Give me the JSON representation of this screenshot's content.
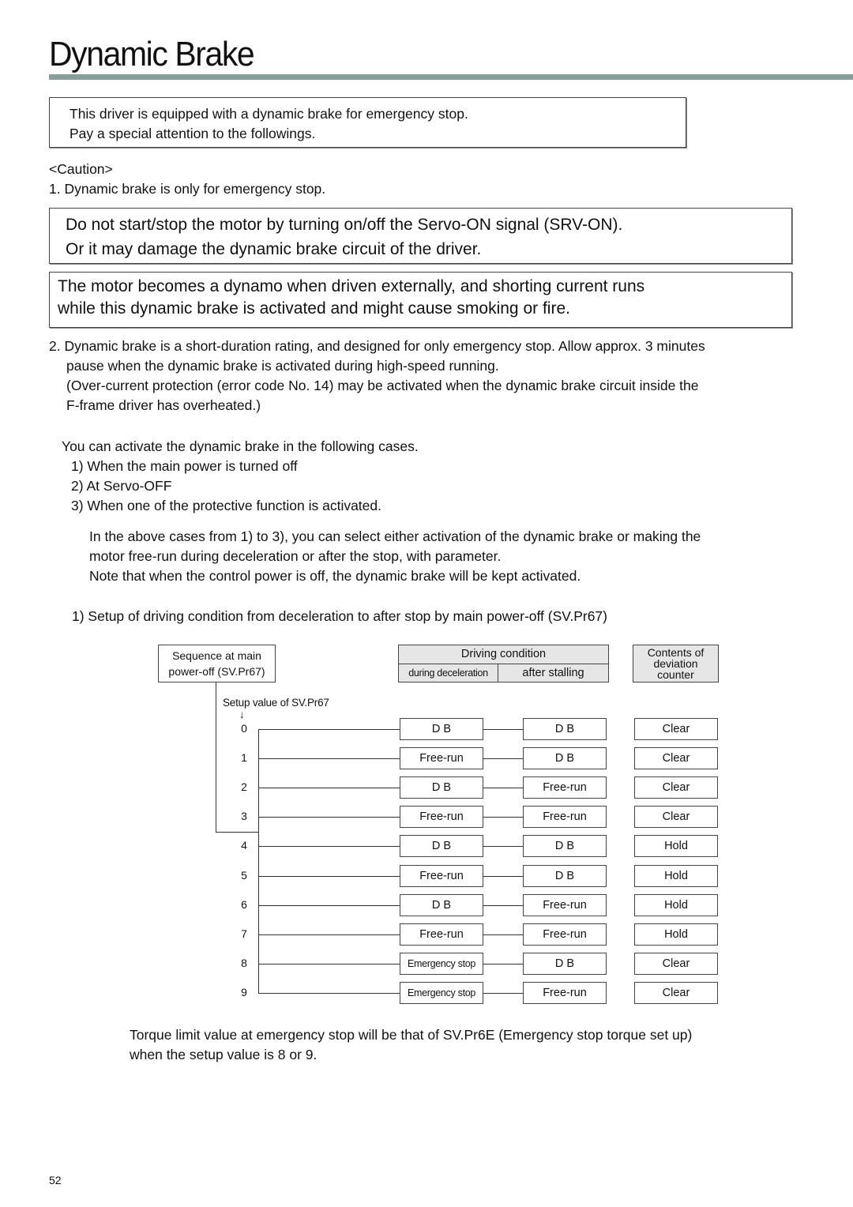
{
  "page": {
    "title": "Dynamic Brake",
    "page_number": "52",
    "accent_color": "#8a9e99"
  },
  "intro": {
    "lines": [
      "This driver is equipped with a dynamic brake for emergency stop.",
      "Pay a special attention to the followings."
    ]
  },
  "caution": {
    "heading": "<Caution>",
    "item1": "1. Dynamic brake is only for emergency stop.",
    "box1_lines": [
      "Do not start/stop the motor by turning on/off the Servo-ON signal (SRV-ON).",
      "Or it may damage the dynamic brake circuit of the driver."
    ],
    "box2_lines": [
      "The motor becomes a dynamo when driven externally, and shorting current runs",
      "while this dynamic brake is activated and might cause smoking or fire."
    ],
    "item2_lines": [
      "2. Dynamic brake is a short-duration rating, and designed for only emergency stop. Allow approx. 3 minutes",
      "pause when the dynamic brake is activated during high-speed running.",
      "(Over-current protection (error code No. 14) may be activated when the dynamic brake circuit inside the",
      "F-frame driver has overheated.)"
    ]
  },
  "cases": {
    "intro": "You can activate the dynamic brake in the following cases.",
    "items": [
      "1) When the main power is turned off",
      "2) At Servo-OFF",
      "3) When one of the protective function is activated."
    ],
    "note_lines": [
      "In the above cases from 1) to 3), you can select either activation of the dynamic brake or making the",
      "motor free-run during deceleration or after the stop, with parameter.",
      "Note that when the control power is off, the dynamic brake will be kept activated."
    ]
  },
  "setup": {
    "heading": "1) Setup of driving condition from deceleration to after stop by main power-off (SV.Pr67)"
  },
  "diagram": {
    "sequence_label_lines": [
      "Sequence at main",
      "power-off (SV.Pr67)"
    ],
    "setup_value_label": "Setup value of SV.Pr67",
    "arrow_glyph": "↓",
    "driving_condition_header": "Driving condition",
    "during_decel_header": "during deceleration",
    "after_stall_header": "after stalling",
    "deviation_header_lines": [
      "Contents of",
      "deviation",
      "counter"
    ],
    "rows": [
      {
        "value": "0",
        "decel": "D  B",
        "stall": "D  B",
        "counter": "Clear"
      },
      {
        "value": "1",
        "decel": "Free-run",
        "stall": "D  B",
        "counter": "Clear"
      },
      {
        "value": "2",
        "decel": "D  B",
        "stall": "Free-run",
        "counter": "Clear"
      },
      {
        "value": "3",
        "decel": "Free-run",
        "stall": "Free-run",
        "counter": "Clear"
      },
      {
        "value": "4",
        "decel": "D  B",
        "stall": "D  B",
        "counter": "Hold"
      },
      {
        "value": "5",
        "decel": "Free-run",
        "stall": "D  B",
        "counter": "Hold"
      },
      {
        "value": "6",
        "decel": "D  B",
        "stall": "Free-run",
        "counter": "Hold"
      },
      {
        "value": "7",
        "decel": "Free-run",
        "stall": "Free-run",
        "counter": "Hold"
      },
      {
        "value": "8",
        "decel": "Emergency stop",
        "stall": "D  B",
        "counter": "Clear"
      },
      {
        "value": "9",
        "decel": "Emergency stop",
        "stall": "Free-run",
        "counter": "Clear"
      }
    ]
  },
  "torque_note_lines": [
    "Torque limit value at emergency stop will be that of SV.Pr6E (Emergency stop torque set up)",
    "when the setup value is 8 or 9."
  ]
}
